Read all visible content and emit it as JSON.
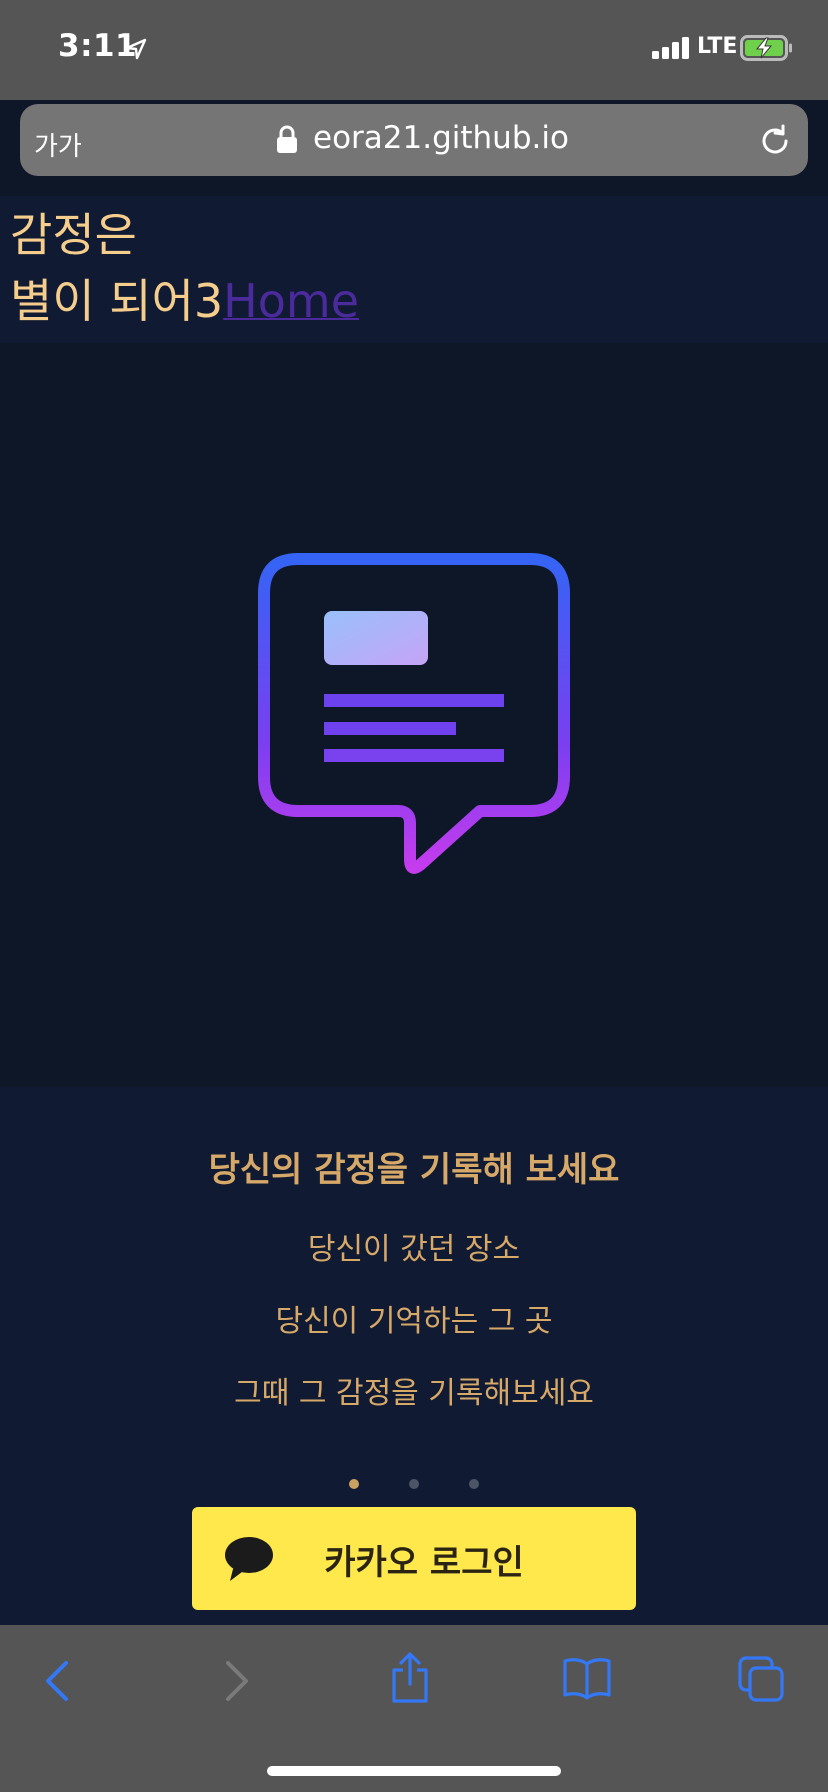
{
  "status_bar": {
    "time": "3:11",
    "network": "LTE"
  },
  "browser": {
    "text_size_label": "가가",
    "url": "eora21.github.io"
  },
  "header": {
    "title_line1": "감정은",
    "title_line2": "별이 되어3",
    "home_link": "Home"
  },
  "panel": {
    "heading": "당신의 감정을 기록해 보세요",
    "lines": [
      "당신이 갔던 장소",
      "당신이 기억하는 그 곳",
      "그때 그 감정을 기록해보세요"
    ],
    "active_slide": 1,
    "slide_count": 3
  },
  "kakao_button": {
    "label": "카카오 로그인"
  },
  "colors": {
    "accent_gold": "#d7a969",
    "header_gold": "#f5ce8d",
    "kakao_yellow": "#fee84c",
    "link_purple": "#4b2a9c",
    "safari_blue": "#3478f6"
  }
}
